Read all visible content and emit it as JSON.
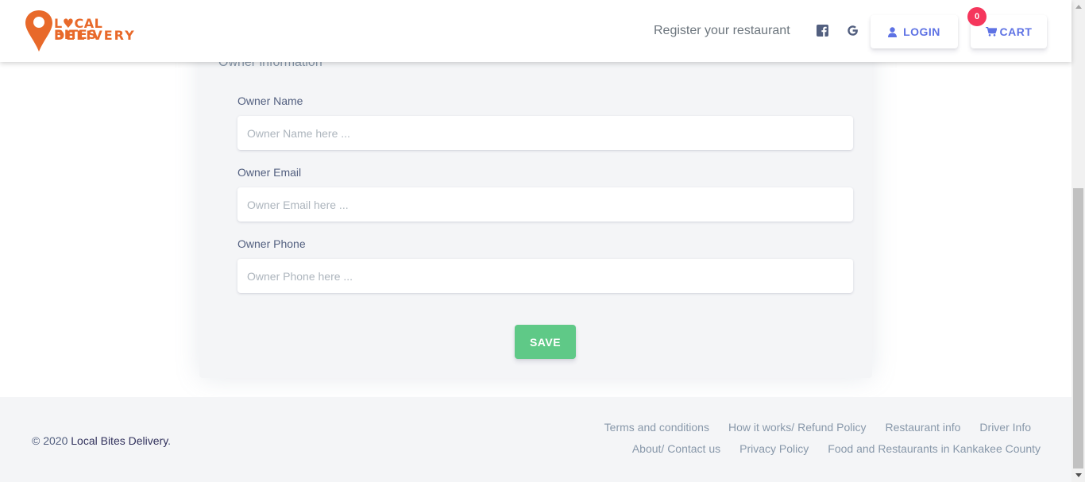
{
  "header": {
    "logo_text_top": "L♥CAL BITES",
    "logo_text_bottom": "DELIVERY",
    "register_link": "Register your restaurant",
    "login_label": "LOGIN",
    "cart_label": "CART",
    "cart_count": "0",
    "icons": {
      "facebook": "facebook-icon",
      "google": "google-icon",
      "user": "user-icon",
      "cart": "cart-icon"
    }
  },
  "form": {
    "section_title": "Owner information",
    "fields": [
      {
        "label": "Owner Name",
        "placeholder": "Owner Name here ...",
        "value": ""
      },
      {
        "label": "Owner Email",
        "placeholder": "Owner Email here ...",
        "value": ""
      },
      {
        "label": "Owner Phone",
        "placeholder": "Owner Phone here ...",
        "value": ""
      }
    ],
    "save_label": "SAVE"
  },
  "footer": {
    "copyright_prefix": "© 2020 ",
    "copyright_brand": "Local Bites Delivery",
    "copyright_suffix": ".",
    "links_row1": [
      "Terms and conditions",
      "How it works/ Refund Policy",
      "Restaurant info",
      "Driver Info"
    ],
    "links_row2": [
      "About/ Contact us",
      "Privacy Policy",
      "Food and Restaurants in Kankakee County"
    ]
  },
  "colors": {
    "brand_orange": "#e8692a",
    "primary": "#5e72e4",
    "success": "#5fc987",
    "danger": "#f5365c"
  }
}
